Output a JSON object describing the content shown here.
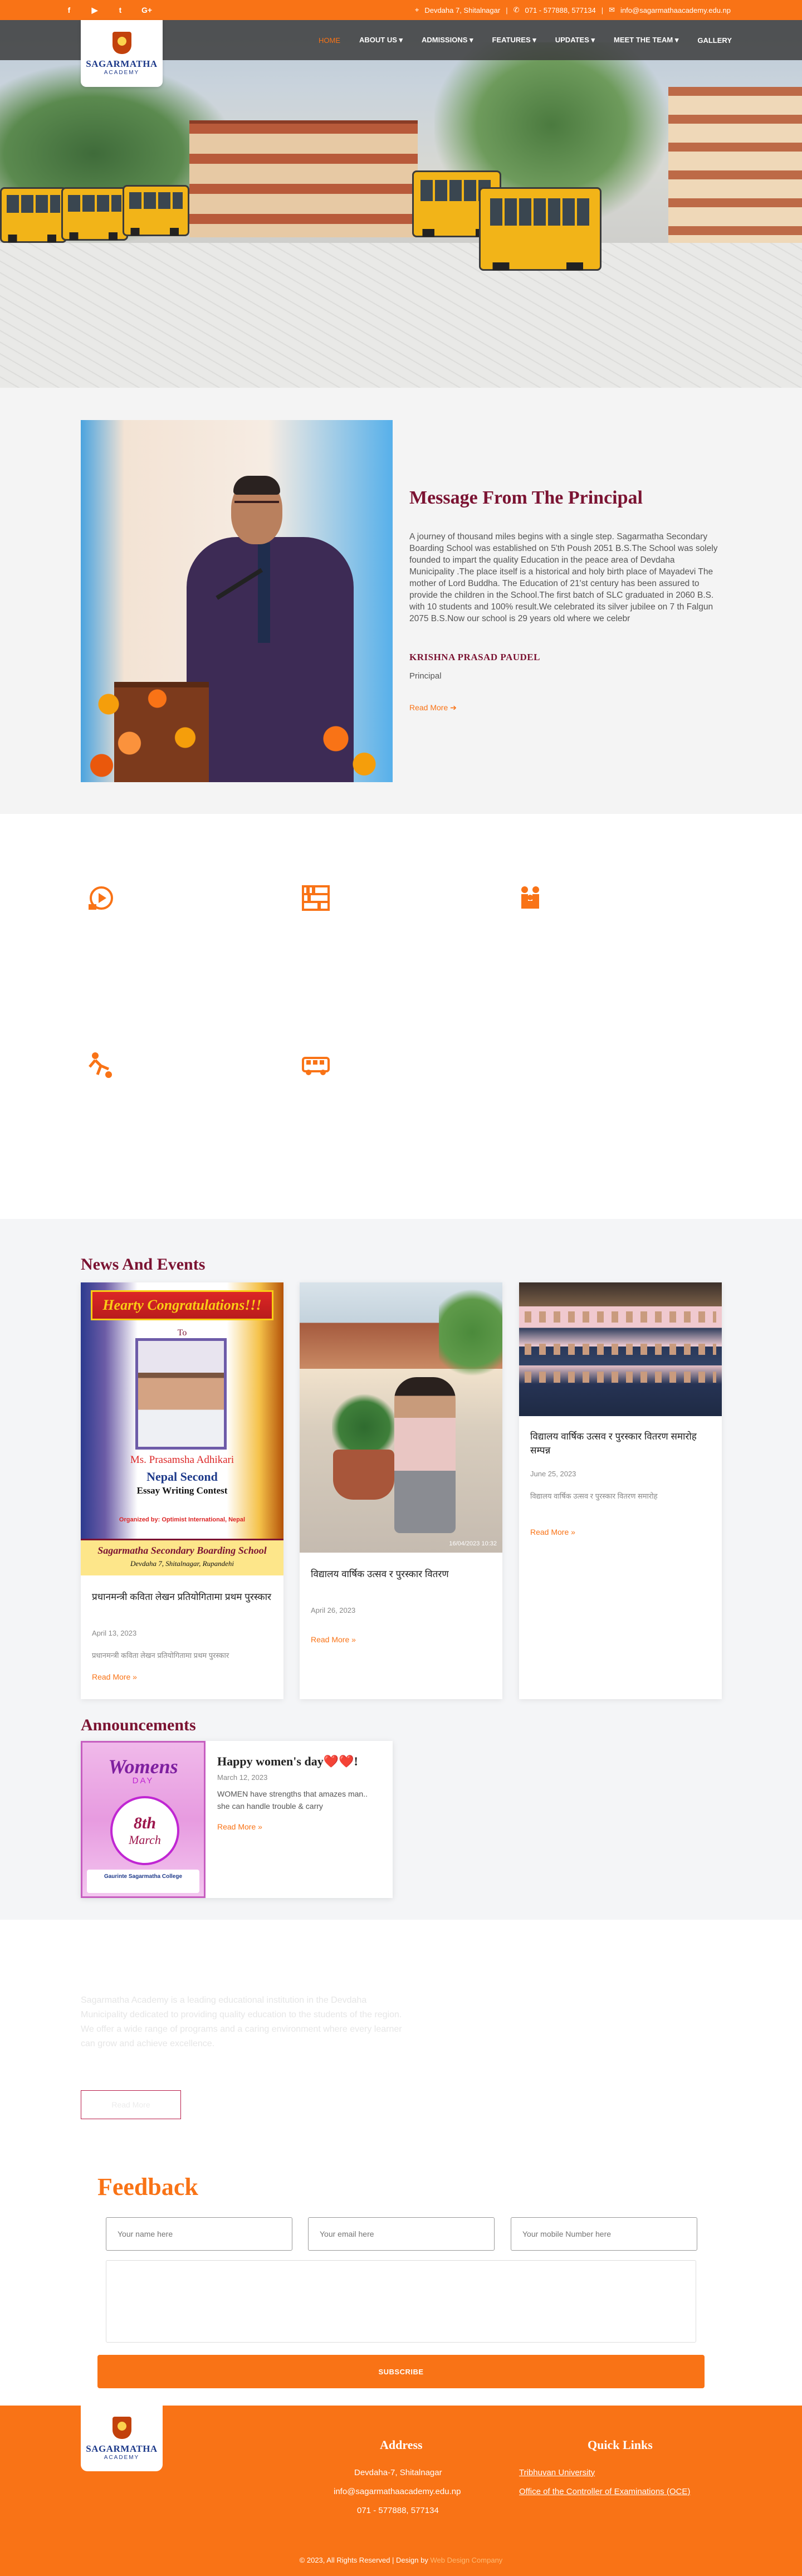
{
  "topbar": {
    "social_icons": [
      "facebook-icon",
      "youtube-icon",
      "twitter-icon",
      "google-plus-icon"
    ],
    "social_glyphs": [
      "f",
      "▶",
      "t",
      "G+"
    ],
    "address": "Devdaha 7, Shitalnagar",
    "phone": "071 - 577888, 577134",
    "email": "info@sagarmathaacademy.edu.np",
    "separator": "|"
  },
  "brand": {
    "name": "SAGARMATHA",
    "sub": "ACADEMY"
  },
  "nav": {
    "items": [
      {
        "label": "HOME",
        "active": true
      },
      {
        "label": "ABOUT US ▾"
      },
      {
        "label": "ADMISSIONS ▾"
      },
      {
        "label": "FEATURES ▾"
      },
      {
        "label": "UPDATES ▾"
      },
      {
        "label": "MEET THE TEAM ▾"
      },
      {
        "label": "GALLERY"
      }
    ]
  },
  "principal": {
    "title": "Message From The Principal",
    "message": "A journey of thousand miles begins with a single step. Sagarmatha Secondary Boarding School was established on 5'th Poush 2051 B.S.The School was solely founded to impart the quality Education in the peace area of Devdaha Municipality .The place itself is a historical and holy birth place of Mayadevi The mother of Lord Buddha. The Education of 21'st century has been assured to provide the children in the School.The first batch of SLC graduated in 2060 B.S. with 10 students and 100% result.We celebrated its silver jubilee on 7 th Falgun 2075 B.S.Now our school is 29 years old where we celebr",
    "name": "KRISHNA PRASAD PAUDEL",
    "role": "Principal",
    "read_more": "Read More ➔"
  },
  "features": {
    "icons": [
      "video-lesson-icon",
      "library-shelf-icon",
      "family-icon",
      "sports-icon",
      "transport-bus-icon"
    ]
  },
  "news": {
    "title": "News And Events",
    "cards": [
      {
        "title": "प्रधानमन्त्री कविता लेखन प्रतियोगितामा प्रथम पुरस्कार",
        "date": "April 13, 2023",
        "excerpt": "प्रधानमन्त्री कविता लेखन प्रतियोगितामा प्रथम पुरस्कार",
        "read_more": "Read More »",
        "poster": {
          "banner": "Hearty Congratulations!!!",
          "to": "To",
          "student": "Ms. Prasamsha Adhikari",
          "position": "Nepal Second",
          "contest": "Essay Writing Contest",
          "organizer": "Organized by: Optimist International, Nepal",
          "school": "Sagarmatha Secondary Boarding School",
          "address": "Devdaha 7, Shitalnagar, Rupandehi"
        }
      },
      {
        "title": "विद्यालय वार्षिक उत्सव र पुरस्कार वितरण",
        "date": "April 26, 2023",
        "excerpt": "",
        "read_more": "Read More »",
        "photo_stamp": "16/04/2023 10:32"
      },
      {
        "title": "विद्यालय वार्षिक उत्सव र पुरस्कार वितरण समारोह सम्पन्न",
        "date": "June 25, 2023",
        "excerpt": "विद्यालय वार्षिक उत्सव र पुरस्कार वितरण समारोह",
        "read_more": "Read More »"
      }
    ]
  },
  "announcements": {
    "title": "Announcements",
    "item": {
      "title": "Happy women's day❤️❤️!",
      "date": "March 12, 2023",
      "text": "WOMEN have strengths that amazes man.. she can handle trouble & carry",
      "read_more": "Read More »",
      "poster": {
        "headline": "Womens",
        "day": "DAY",
        "date_day": "8th",
        "date_month": "March",
        "college": "Gaurinte Sagarmatha College"
      }
    }
  },
  "about": {
    "text": "Sagarmatha Academy is a leading educational institution in the Devdaha Municipality dedicated to providing quality education to the students of the region. We offer a wide range of programs and a caring environment where every learner can grow and achieve excellence.",
    "button": "Read More"
  },
  "feedback": {
    "title": "Feedback",
    "name_placeholder": "Your name here",
    "email_placeholder": "Your email here",
    "mobile_placeholder": "Your mobile Number here",
    "message_placeholder": "",
    "submit": "SUBSCRIBE"
  },
  "footer": {
    "address_title": "Address",
    "address_lines": [
      "Devdaha-7, Shitalnagar",
      "info@sagarmathaacademy.edu.np",
      "071 - 577888, 577134"
    ],
    "links_title": "Quick Links",
    "links": [
      "Tribhuvan University",
      "Office of the Controller of Examinations (OCE)"
    ],
    "copyright": "© 2023, All Rights Reserved | Design by",
    "designer": "Web Design Company"
  },
  "colors": {
    "accent": "#f97316",
    "maroon": "#7b1332"
  }
}
